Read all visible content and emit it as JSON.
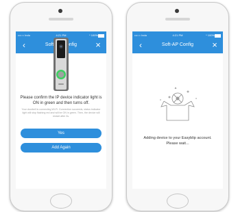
{
  "colors": {
    "accent": "#2e8fdc",
    "led_green": "#3fcf63"
  },
  "left_phone": {
    "status": {
      "carrier": "•••○○ Indu",
      "time": "4:21 PM",
      "battery": "* 100%"
    },
    "title": "Soft-AP Config",
    "instruction": "Please confirm the IP device indicator light is ON in green and then turns off.",
    "hint": "Your doorbell is connecting Wi-Fi. Connection succeeds, status indicator light will stop flashing red and will be ON in green. Then, the device will restart after 3s.",
    "buttons": {
      "yes": "Yes",
      "add_again": "Add Again"
    },
    "icons": {
      "back": "chevron-left-icon",
      "close": "close-icon"
    }
  },
  "right_phone": {
    "status": {
      "carrier": "•••○○ Indu",
      "time": "4:21 PM",
      "battery": "* 100%"
    },
    "title": "Soft-AP Config",
    "message_line1": "Adding device to your Easyblip account.",
    "message_line2": "Please wait...",
    "icons": {
      "back": "chevron-left-icon",
      "close": "close-icon"
    }
  }
}
